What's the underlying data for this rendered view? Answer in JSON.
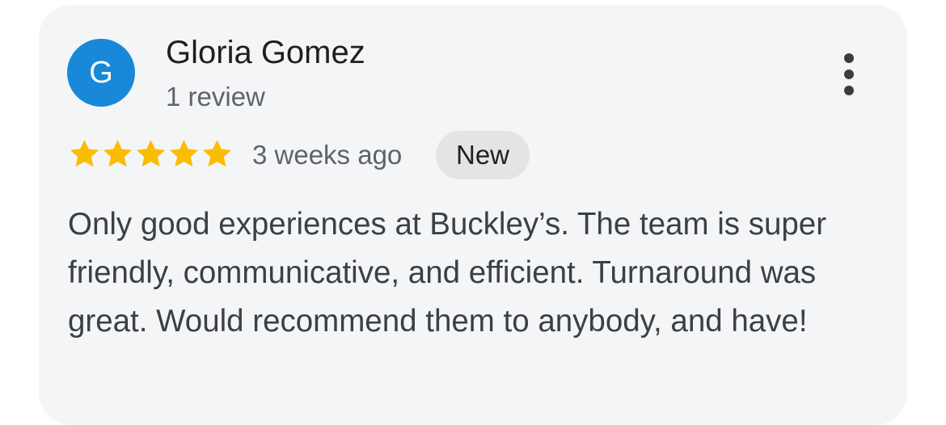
{
  "review": {
    "avatar_letter": "G",
    "avatar_color": "#1a88d8",
    "author_name": "Gloria Gomez",
    "author_meta": "1 review",
    "more_icon": "more-vertical-icon",
    "rating": 5,
    "rating_max": 5,
    "star_color": "#fbbc04",
    "time_ago": "3 weeks ago",
    "badge": "New",
    "text": "Only good experiences at Buckley’s. The team is super friendly, communicative, and efficient. Turnaround was great. Would recommend them to anybody, and have!"
  }
}
